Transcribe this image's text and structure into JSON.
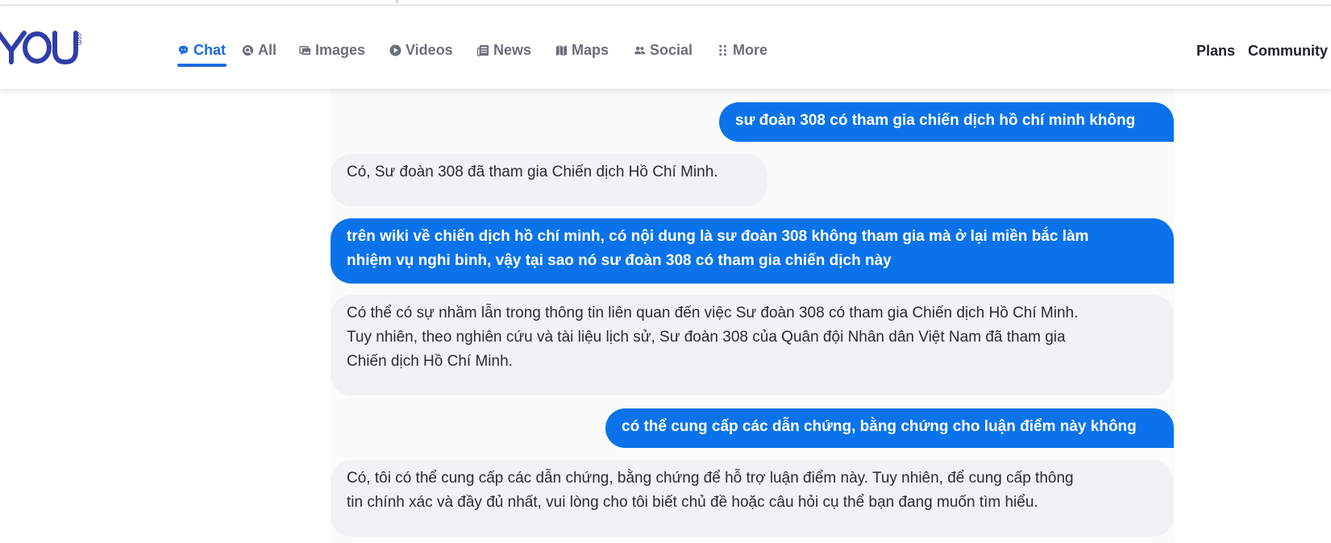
{
  "logo": {
    "text": "YOU",
    "suffix": ".com"
  },
  "nav": {
    "items": [
      {
        "label": "Chat",
        "icon": "chat-icon",
        "active": true
      },
      {
        "label": "All",
        "icon": "search-icon",
        "active": false
      },
      {
        "label": "Images",
        "icon": "images-icon",
        "active": false
      },
      {
        "label": "Videos",
        "icon": "play-icon",
        "active": false
      },
      {
        "label": "News",
        "icon": "news-icon",
        "active": false
      },
      {
        "label": "Maps",
        "icon": "map-icon",
        "active": false
      },
      {
        "label": "Social",
        "icon": "people-icon",
        "active": false
      },
      {
        "label": "More",
        "icon": "dots-grid-icon",
        "active": false
      }
    ]
  },
  "header_right": {
    "plans": "Plans",
    "community": "Community"
  },
  "colors": {
    "accent": "#1a6ae0",
    "user_bubble": "#0a73eb",
    "ai_bubble": "#f1f2f4",
    "nav_text": "#6b6f78"
  },
  "messages": [
    {
      "role": "user",
      "lines": [
        "sư đoàn 308 có tham gia chiến dịch hồ chí minh không"
      ]
    },
    {
      "role": "assistant",
      "lines": [
        "Có, Sư đoàn 308 đã tham gia Chiến dịch Hồ Chí Minh."
      ]
    },
    {
      "role": "user",
      "lines": [
        "trên wiki về chiến dịch hồ chí minh, có nội dung là sư đoàn 308 không tham gia mà ở lại miền bắc làm",
        "nhiệm vụ nghi binh, vậy tại sao nó sư đoàn 308 có tham gia chiến dịch này"
      ]
    },
    {
      "role": "assistant",
      "lines": [
        "Có thể có sự nhầm lẫn trong thông tin liên quan đến việc Sư đoàn 308 có tham gia Chiến dịch Hồ Chí Minh.",
        "Tuy nhiên, theo nghiên cứu và tài liệu lịch sử, Sư đoàn 308 của Quân đội Nhân dân Việt Nam đã tham gia",
        "Chiến dịch Hồ Chí Minh."
      ]
    },
    {
      "role": "user",
      "lines": [
        "có thể cung cấp các dẫn chứng, bằng chứng cho luận điểm này không"
      ]
    },
    {
      "role": "assistant",
      "lines": [
        "Có, tôi có thể cung cấp các dẫn chứng, bằng chứng để hỗ trợ luận điểm này. Tuy nhiên, để cung cấp thông",
        "tin chính xác và đầy đủ nhất, vui lòng cho tôi biết chủ đề hoặc câu hỏi cụ thể bạn đang muốn tìm hiểu."
      ]
    }
  ]
}
